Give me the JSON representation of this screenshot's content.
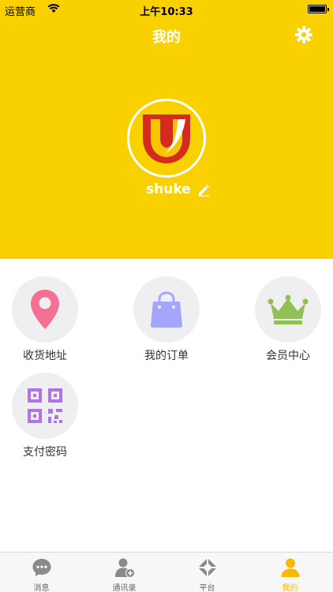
{
  "status_bar": {
    "carrier": "运营商",
    "time": "上午10:33"
  },
  "nav": {
    "title": "我的"
  },
  "profile": {
    "username": "shuke"
  },
  "menu": {
    "items": [
      {
        "label": "收货地址",
        "icon": "location-pin-icon",
        "color": "#f46f94"
      },
      {
        "label": "我的订单",
        "icon": "shopping-bag-icon",
        "color": "#a5a6fb"
      },
      {
        "label": "会员中心",
        "icon": "crown-icon",
        "color": "#8fc051"
      },
      {
        "label": "支付密码",
        "icon": "qr-code-icon",
        "color": "#b173e7"
      }
    ]
  },
  "tabbar": {
    "items": [
      {
        "label": "消息",
        "icon": "chat-bubble-icon"
      },
      {
        "label": "通讯录",
        "icon": "add-contact-icon"
      },
      {
        "label": "平台",
        "icon": "platform-icon"
      },
      {
        "label": "我的",
        "icon": "person-icon",
        "active": true
      }
    ]
  },
  "colors": {
    "header": "#f9d100",
    "active_tab": "#f9b900"
  }
}
